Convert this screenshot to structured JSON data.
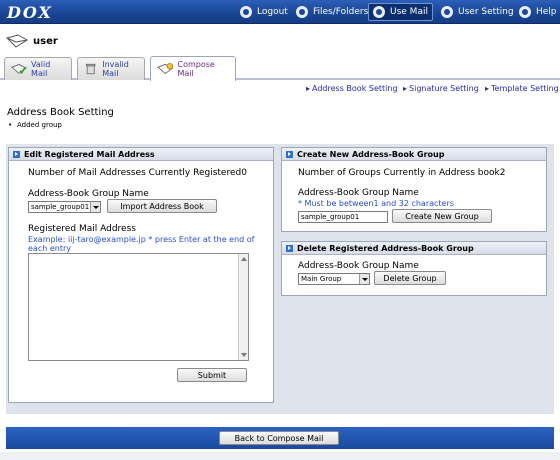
{
  "app": {
    "logo": "DOX"
  },
  "nav": [
    {
      "label": "Logout",
      "icon": "logout-icon"
    },
    {
      "label": "Files/Folders",
      "icon": "folders-icon"
    },
    {
      "label": "Use Mail",
      "icon": "mail-icon",
      "active": true
    },
    {
      "label": "User Setting",
      "icon": "user-setting-icon"
    },
    {
      "label": "Help",
      "icon": "help-icon"
    }
  ],
  "user": {
    "name": "user"
  },
  "tabs": [
    {
      "label": "Valid Mail"
    },
    {
      "label": "Invalid Mail"
    },
    {
      "label": "Compose Mail",
      "active": true
    }
  ],
  "sublinks": [
    "Address Book Setting",
    "Signature Setting",
    "Template Setting"
  ],
  "page": {
    "title": "Address Book Setting",
    "message": "Added group"
  },
  "edit_panel": {
    "title": "Edit Registered Mail Address",
    "count_label": "Number of Mail Addresses Currently Registered",
    "count_value": "0",
    "group_label": "Address-Book Group Name",
    "group_selected": "sample_group01",
    "import_button": "Import Address Book",
    "registered_label": "Registered Mail Address",
    "example_note": "Example: iij-taro@example.jp * press Enter at the end of each entry",
    "submit_button": "Submit"
  },
  "create_panel": {
    "title": "Create New Address-Book Group",
    "count_label": "Number of Groups Currently in Address book",
    "count_value": "2",
    "group_label": "Address-Book Group Name",
    "constraint_note": "* Must be between1 and 32 characters",
    "group_input_value": "sample_group01",
    "create_button": "Create New Group"
  },
  "delete_panel": {
    "title": "Delete Registered Address-Book Group",
    "group_label": "Address-Book Group Name",
    "group_selected": "Main Group",
    "delete_button": "Delete Group"
  },
  "footer": {
    "back_button": "Back to Compose Mail"
  },
  "colors": {
    "topbar": "#1b4796",
    "accent": "#2f6fd0",
    "note": "#2a4fd0",
    "link": "#2a2aa8"
  }
}
